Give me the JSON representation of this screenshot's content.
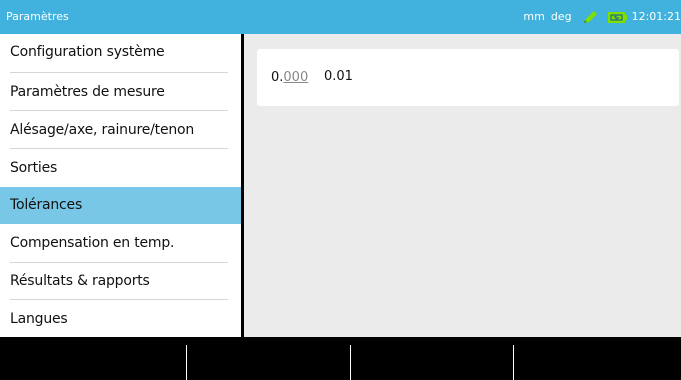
{
  "titlebar": {
    "title": "Paramètres",
    "unit_length": "mm",
    "unit_angle": "deg",
    "time": "12:01:21",
    "accent_color": "#41b2de",
    "status_icons": [
      "pen-icon",
      "battery-icon"
    ]
  },
  "sidebar": {
    "items": [
      {
        "label": "Configuration système"
      },
      {
        "label": "Paramètres de mesure"
      },
      {
        "label": "Alésage/axe, rainure/tenon"
      },
      {
        "label": "Sorties"
      },
      {
        "label": "Tolérances",
        "selected": true
      },
      {
        "label": "Compensation en temp."
      },
      {
        "label": "Résultats & rapports"
      },
      {
        "label": "Langues"
      }
    ],
    "selected_color": "#78c7e7"
  },
  "content": {
    "tolerance": {
      "prefix": "0.",
      "placeholder_digits": "000",
      "value": "0.01"
    }
  },
  "softkeys": [
    "",
    "",
    "",
    ""
  ]
}
